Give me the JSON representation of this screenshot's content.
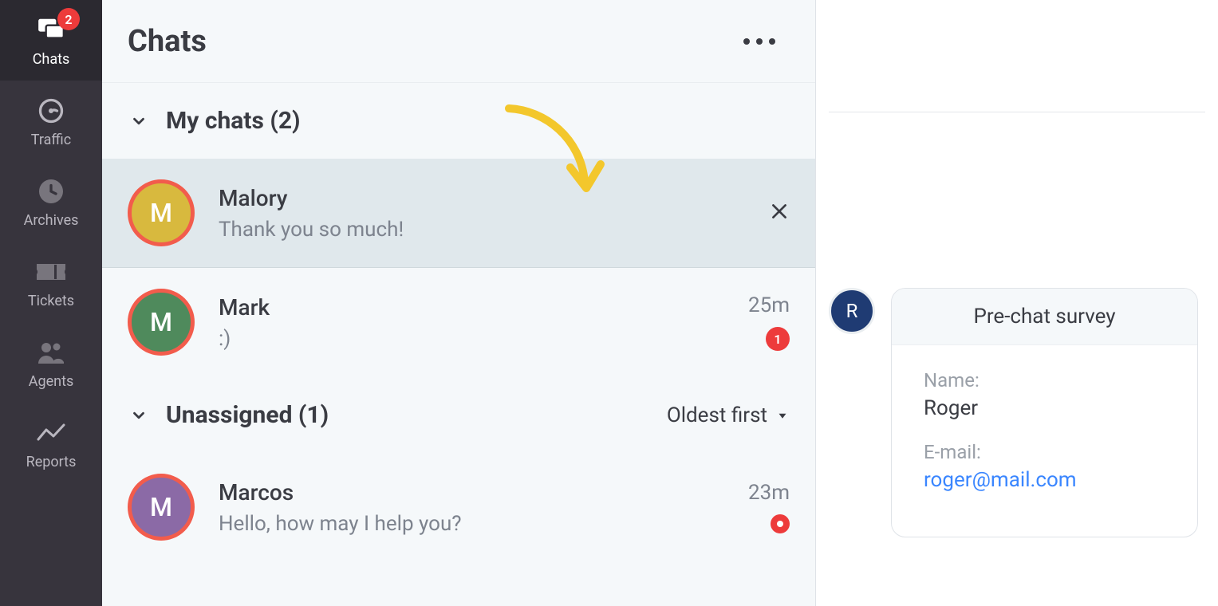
{
  "sidebar": {
    "badge": "2",
    "items": [
      {
        "label": "Chats"
      },
      {
        "label": "Traffic"
      },
      {
        "label": "Archives"
      },
      {
        "label": "Tickets"
      },
      {
        "label": "Agents"
      },
      {
        "label": "Reports"
      }
    ]
  },
  "list": {
    "title": "Chats",
    "sections": {
      "mychats": {
        "title": "My chats (2)",
        "items": [
          {
            "initial": "M",
            "name": "Malory",
            "preview": "Thank you so much!",
            "time": "",
            "unread": "",
            "selected": true
          },
          {
            "initial": "M",
            "name": "Mark",
            "preview": ":)",
            "time": "25m",
            "unread": "1",
            "selected": false
          }
        ]
      },
      "unassigned": {
        "title": "Unassigned (1)",
        "sort_label": "Oldest first",
        "items": [
          {
            "initial": "M",
            "name": "Marcos",
            "preview": "Hello, how may I help you?",
            "time": "23m",
            "dot": true
          }
        ]
      }
    }
  },
  "right": {
    "avatar_initial": "R",
    "card_title": "Pre-chat survey",
    "fields": {
      "name_label": "Name:",
      "name_value": "Roger",
      "email_label": "E-mail:",
      "email_value": "roger@mail.com"
    }
  }
}
